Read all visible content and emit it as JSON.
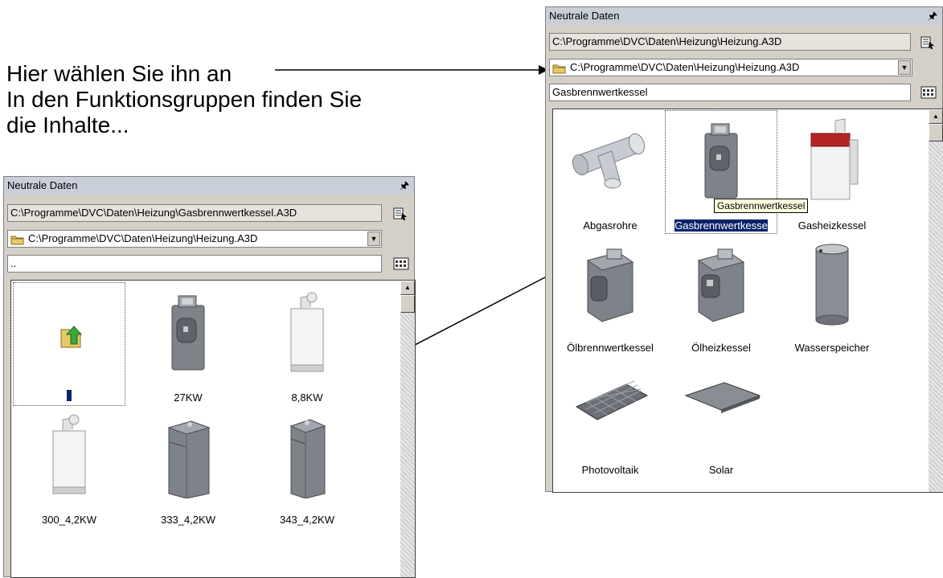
{
  "caption": {
    "line1": "Hier wählen Sie ihn an",
    "line2": "In den Funktionsgruppen finden Sie",
    "line3": "die Inhalte..."
  },
  "right_panel": {
    "title": "Neutrale Daten",
    "pin_icon": "pin-icon",
    "path": "C:\\Programme\\DVC\\Daten\\Heizung\\Heizung.A3D",
    "combo_value": "C:\\Programme\\DVC\\Daten\\Heizung\\Heizung.A3D",
    "filter": "Gasbrennwertkessel",
    "tooltip": "Gasbrennwertkessel",
    "items": [
      {
        "label": "Abgasrohre",
        "icon": "pipe-icon"
      },
      {
        "label": "Gasbrennwertkesse",
        "icon": "boiler-icon"
      },
      {
        "label": "Gasheizkessel",
        "icon": "wall-boiler-icon"
      },
      {
        "label": "Ölbrennwertkessel",
        "icon": "oil-boiler-icon"
      },
      {
        "label": "Ölheizkessel",
        "icon": "oil-heater-icon"
      },
      {
        "label": "Wasserspeicher",
        "icon": "water-tank-icon"
      },
      {
        "label": "Photovoltaik",
        "icon": "solar-panel-icon"
      },
      {
        "label": "Solar",
        "icon": "solar-collector-icon"
      }
    ]
  },
  "left_panel": {
    "title": "Neutrale Daten",
    "path": "C:\\Programme\\DVC\\Daten\\Heizung\\Gasbrennwertkessel.A3D",
    "combo_value": "C:\\Programme\\DVC\\Daten\\Heizung\\Heizung.A3D",
    "filter": "..",
    "items": [
      {
        "label": "",
        "icon": "folder-up-icon"
      },
      {
        "label": "27KW",
        "icon": "boiler-icon"
      },
      {
        "label": "8,8KW",
        "icon": "wall-boiler-white-icon"
      },
      {
        "label": "300_4,2KW",
        "icon": "wall-boiler-white-icon"
      },
      {
        "label": "333_4,2KW",
        "icon": "standing-boiler-icon"
      },
      {
        "label": "343_4,2KW",
        "icon": "standing-boiler-icon"
      }
    ]
  }
}
